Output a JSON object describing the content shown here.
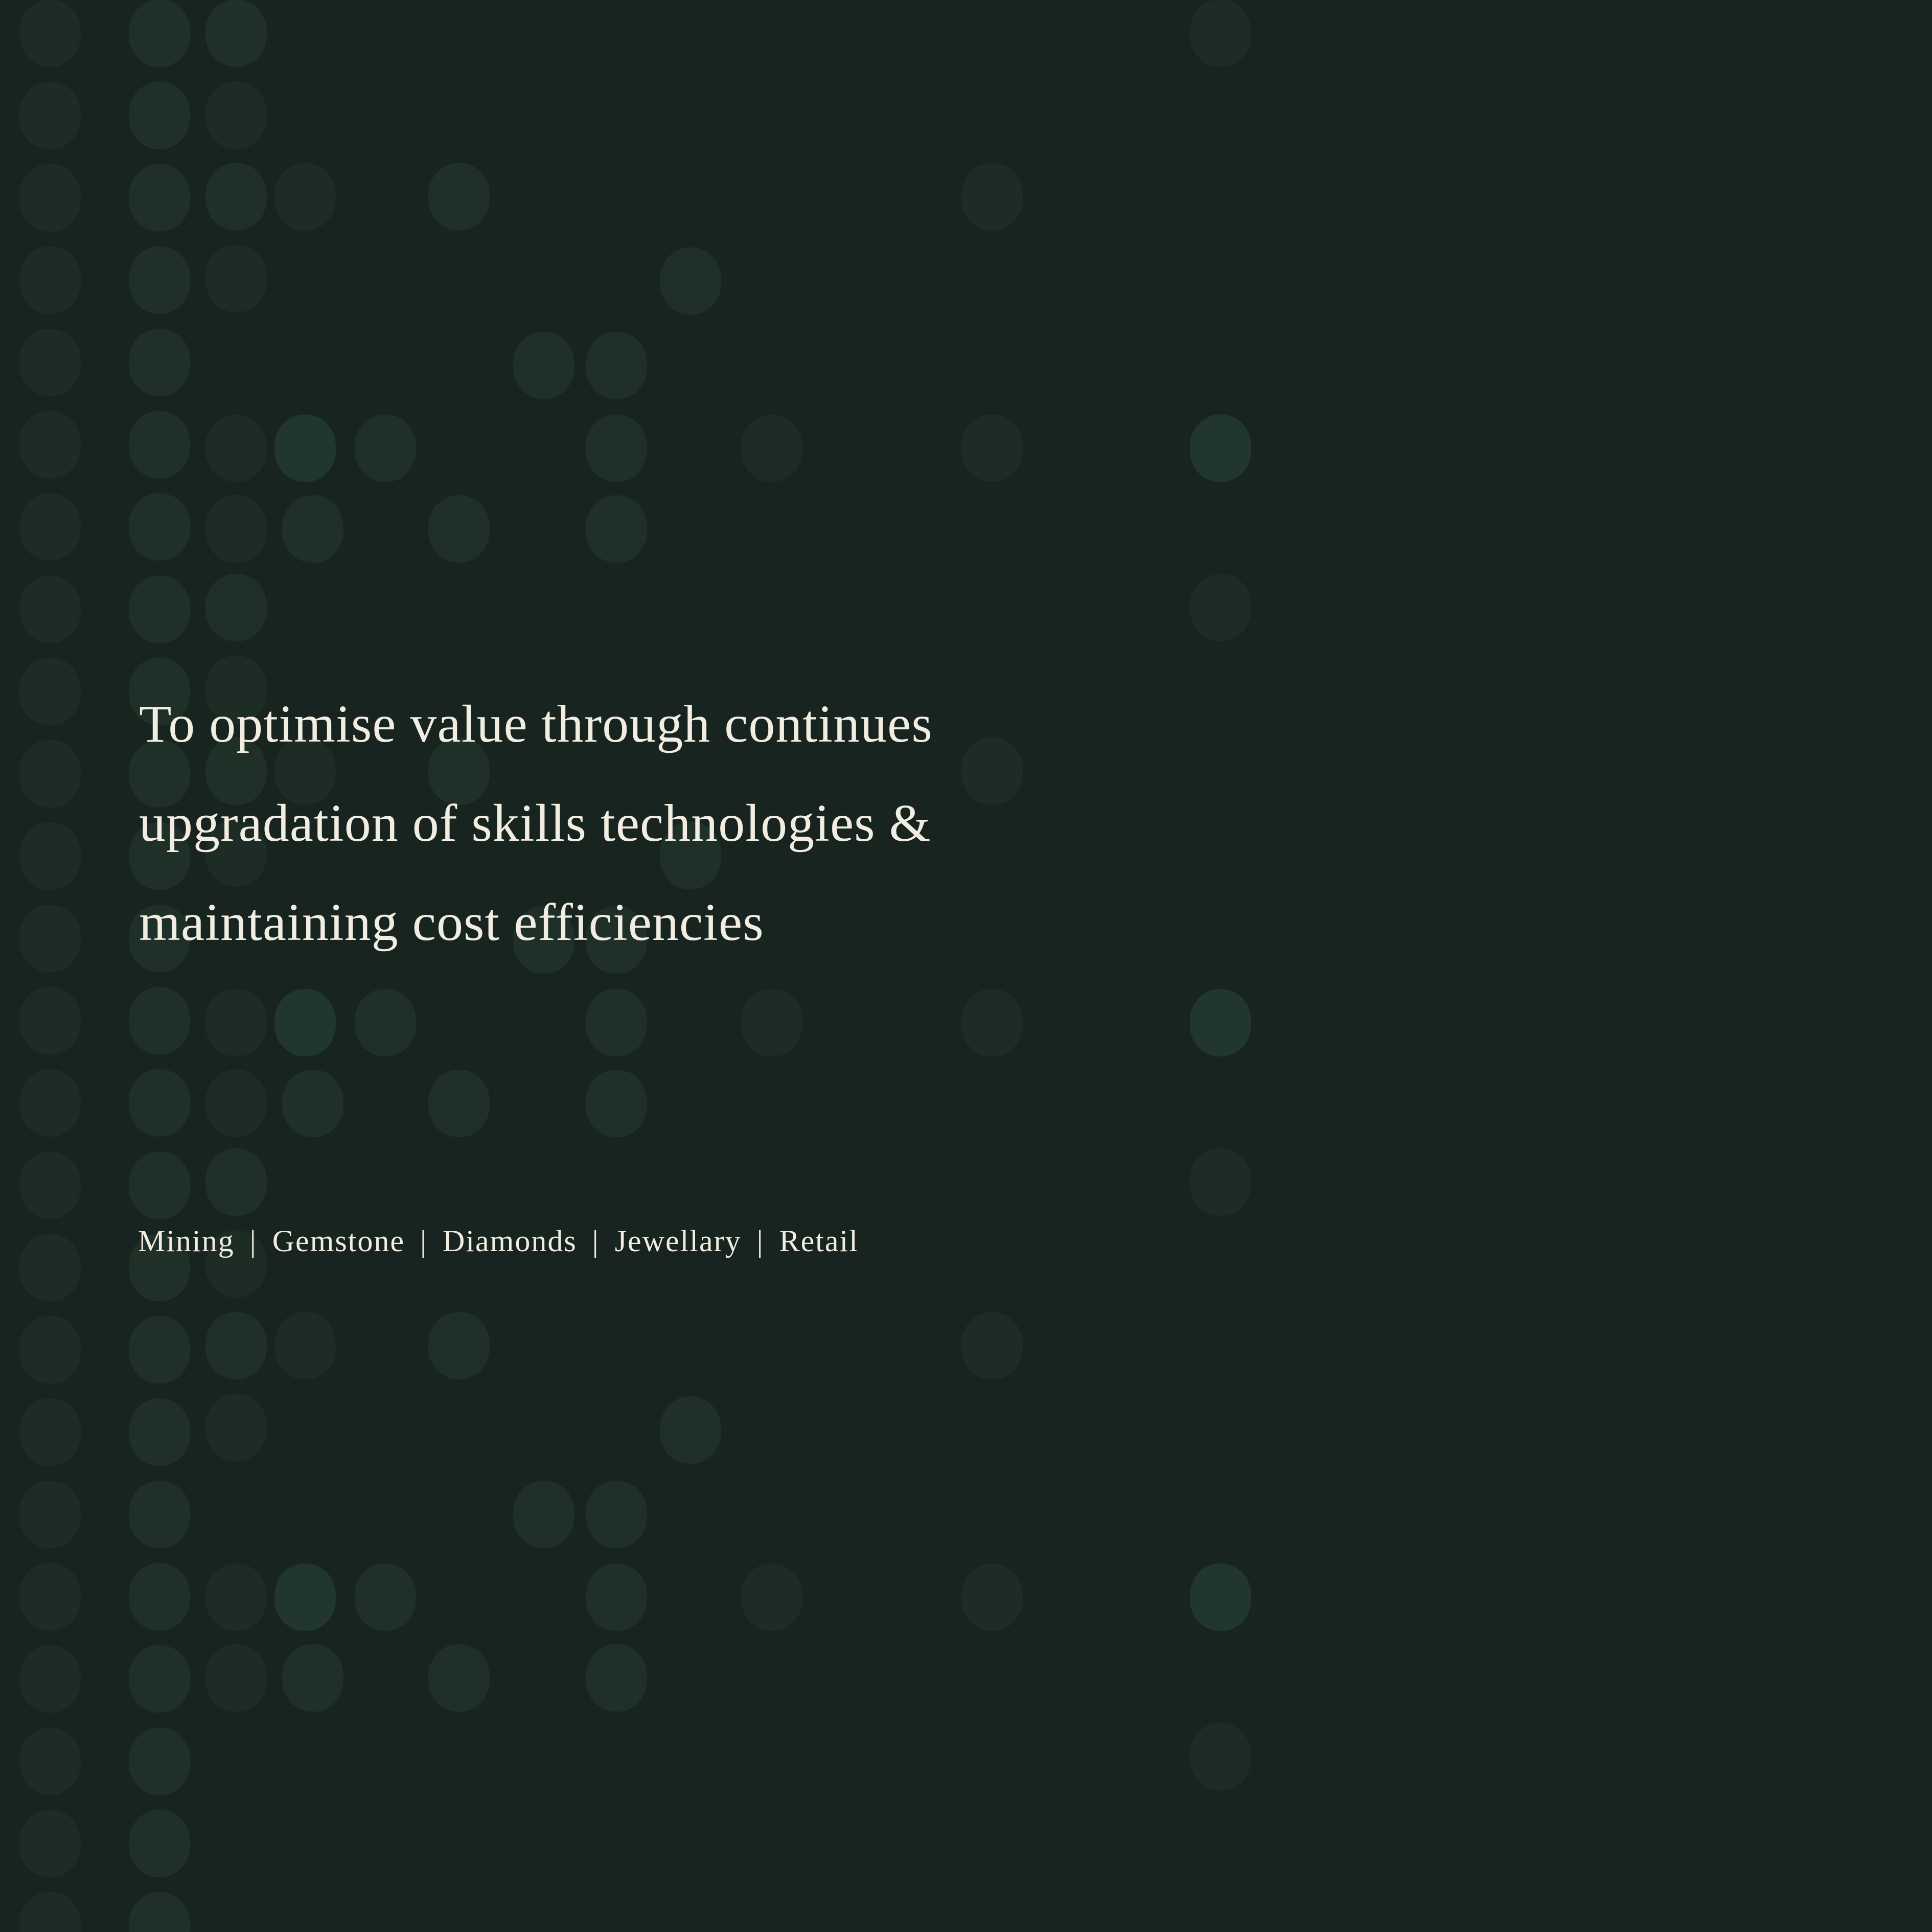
{
  "colors": {
    "background": "#18241f",
    "dot_dim": "#1d2c25",
    "dot_mid": "#1f3029",
    "dot_bright": "#223630",
    "text": "#f2ede1"
  },
  "mission": {
    "lines": [
      "To optimise value through continues",
      "upgradation of skills technologies &",
      "maintaining cost efficiencies"
    ]
  },
  "segments": {
    "items": [
      "Mining",
      "Gemstone",
      "Diamonds",
      "Jewellary",
      "Retail"
    ],
    "separator": "|"
  }
}
